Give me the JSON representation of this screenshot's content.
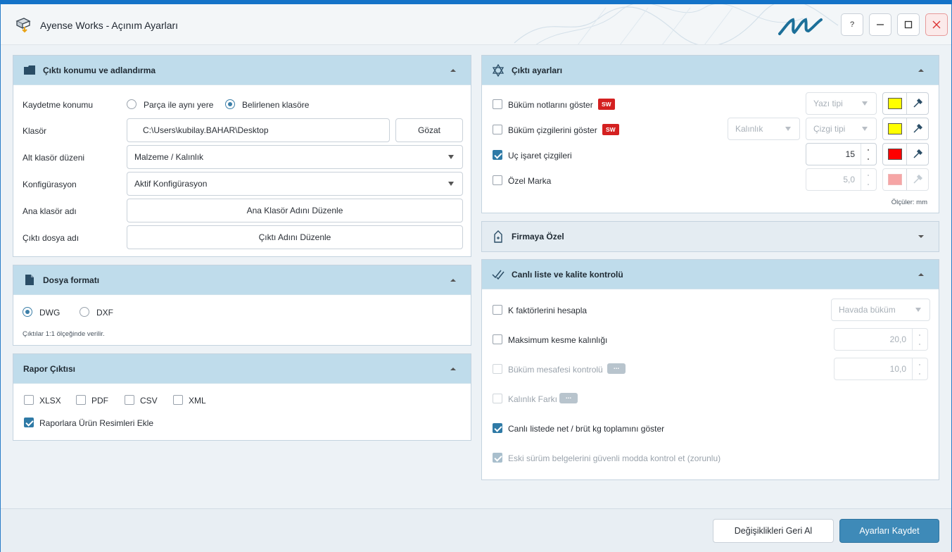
{
  "window": {
    "title": "Ayense Works - Açınım Ayarları",
    "help_label": "?"
  },
  "output_location": {
    "header": "Çıktı konumu ve adlandırma",
    "save_location_label": "Kaydetme konumu",
    "radio_same_place": "Parça ile aynı yere",
    "radio_specified_folder": "Belirlenen klasöre",
    "selected_radio": "Belirlenen klasöre",
    "folder_label": "Klasör",
    "folder_value": "C:\\Users\\kubilay.BAHAR\\Desktop",
    "browse_button": "Gözat",
    "subfolder_label": "Alt klasör düzeni",
    "subfolder_value": "Malzeme / Kalınlık",
    "config_label": "Konfigürasyon",
    "config_value": "Aktif Konfigürasyon",
    "main_folder_label": "Ana klasör adı",
    "main_folder_button": "Ana Klasör Adını Düzenle",
    "output_file_label": "Çıktı dosya adı",
    "output_file_button": "Çıktı Adını Düzenle"
  },
  "file_format": {
    "header": "Dosya formatı",
    "option_dwg": "DWG",
    "option_dxf": "DXF",
    "selected": "DWG",
    "note": "Çıktılar 1:1 ölçeğinde verilir."
  },
  "report": {
    "header": "Rapor Çıktısı",
    "xlsx": "XLSX",
    "pdf": "PDF",
    "csv": "CSV",
    "xml": "XML",
    "xlsx_checked": false,
    "pdf_checked": false,
    "csv_checked": false,
    "xml_checked": false,
    "add_images_label": "Raporlara Ürün Resimleri Ekle",
    "add_images_checked": true
  },
  "output_settings": {
    "header": "Çıktı ayarları",
    "bend_notes_label": "Büküm notlarını göster",
    "bend_lines_label": "Büküm çizgilerini göster",
    "sw_badge": "SW",
    "font_type_placeholder": "Yazı tipi",
    "thickness_placeholder": "Kalınlık",
    "line_type_placeholder": "Çizgi tipi",
    "tip_marks_label": "Uç işaret çizgileri",
    "tip_marks_checked": true,
    "tip_marks_value": "15",
    "custom_mark_label": "Özel Marka",
    "custom_mark_value": "5,0",
    "units_note": "Ölçüler: mm",
    "colors": {
      "bend_notes": "#ffff00",
      "bend_lines": "#ffff00",
      "tip_marks": "#ff0000",
      "custom_mark": "#f6a5a5"
    }
  },
  "company": {
    "header": "Firmaya Özel"
  },
  "live_list": {
    "header": "Canlı liste ve kalite kontrolü",
    "k_factor_label": "K faktörlerini hesapla",
    "k_factor_select": "Havada büküm",
    "max_cut_label": "Maksimum kesme kalınlığı",
    "max_cut_value": "20,0",
    "bend_distance_label": "Büküm mesafesi kontrolü",
    "bend_distance_value": "10,0",
    "thickness_diff_label": "Kalınlık Farkı",
    "dots_label": "...",
    "net_gross_label": "Canlı listede net / brüt kg toplamını göster",
    "net_gross_checked": true,
    "legacy_label": "Eski sürüm belgelerini güvenli modda kontrol et (zorunlu)",
    "legacy_checked": true
  },
  "footer": {
    "revert_button": "Değişiklikleri Geri Al",
    "save_button": "Ayarları Kaydet"
  },
  "theme": {
    "accent": "#2f7aa6",
    "header_band": "#bfdceb",
    "save_button_bg": "#3e8ab8"
  }
}
